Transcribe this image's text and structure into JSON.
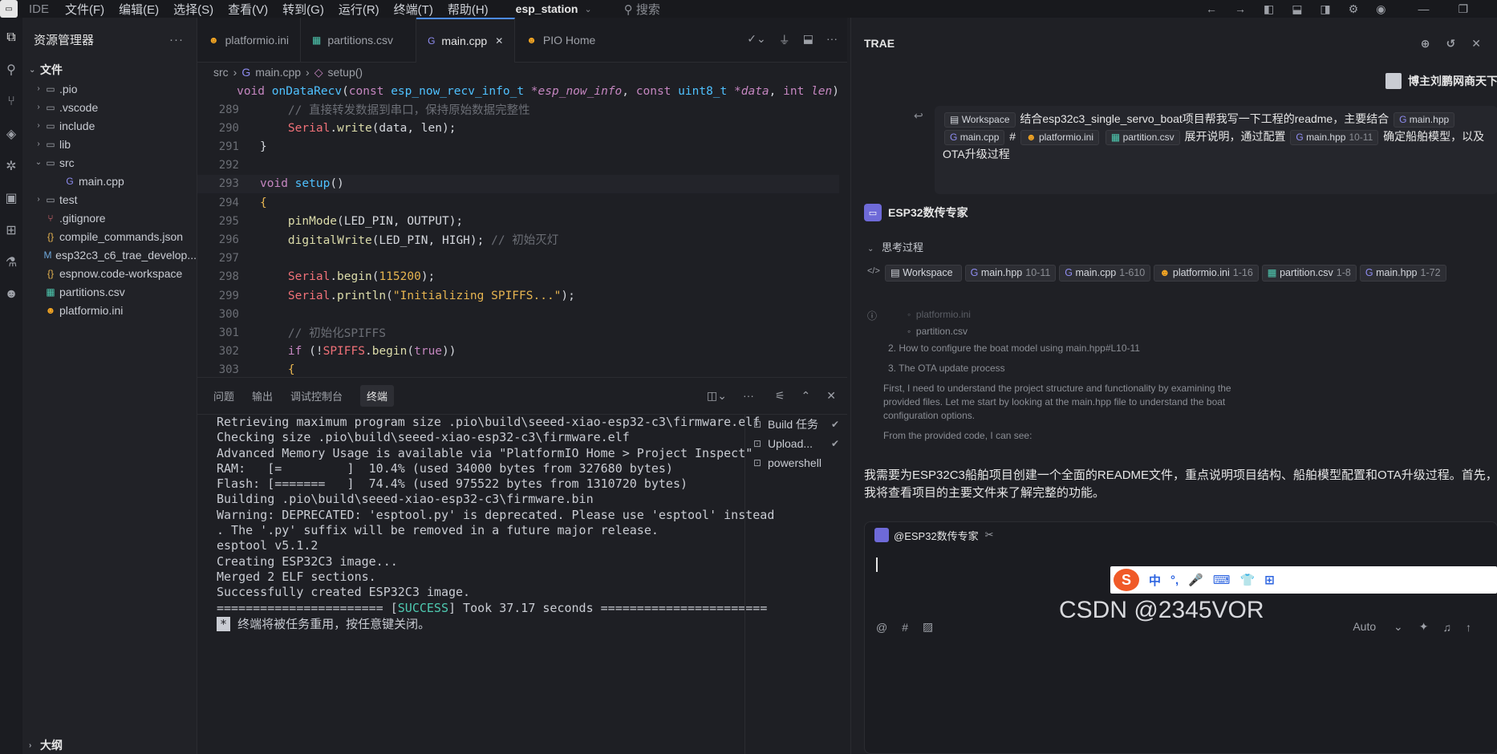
{
  "titlebar": {
    "ide": "IDE",
    "menu": [
      "文件(F)",
      "编辑(E)",
      "选择(S)",
      "查看(V)",
      "转到(G)",
      "运行(R)",
      "终端(T)",
      "帮助(H)"
    ],
    "project": "esp_station",
    "search": "搜索"
  },
  "explorer": {
    "title": "资源管理器",
    "section": "文件",
    "items": [
      {
        "arrow": "›",
        "icon": "folder-icon",
        "glyph": "▭",
        "label": ".pio"
      },
      {
        "arrow": "›",
        "icon": "folder-icon",
        "glyph": "▭",
        "label": ".vscode"
      },
      {
        "arrow": "›",
        "icon": "folder-icon",
        "glyph": "▭",
        "label": "include"
      },
      {
        "arrow": "›",
        "icon": "folder-icon",
        "glyph": "▭",
        "label": "lib"
      },
      {
        "arrow": "⌄",
        "icon": "folder-open-icon",
        "glyph": "▭",
        "label": "src"
      },
      {
        "arrow": "",
        "icon": "cpp-file-icon",
        "glyph": "G",
        "label": "main.cpp",
        "indent": true
      },
      {
        "arrow": "›",
        "icon": "folder-icon",
        "glyph": "▭",
        "label": "test"
      },
      {
        "arrow": "",
        "icon": "git-icon",
        "glyph": "⑂",
        "label": ".gitignore"
      },
      {
        "arrow": "",
        "icon": "json-icon",
        "glyph": "{}",
        "label": "compile_commands.json"
      },
      {
        "arrow": "",
        "icon": "markdown-icon",
        "glyph": "M",
        "label": "esp32c3_c6_trae_develop..."
      },
      {
        "arrow": "",
        "icon": "json-icon",
        "glyph": "{}",
        "label": "espnow.code-workspace"
      },
      {
        "arrow": "",
        "icon": "csv-icon",
        "glyph": "▦",
        "label": "partitions.csv"
      },
      {
        "arrow": "",
        "icon": "pio-icon",
        "glyph": "☻",
        "label": "platformio.ini"
      }
    ],
    "outline": "大纲"
  },
  "tabs": [
    {
      "label": "platformio.ini",
      "icon": "pio-icon",
      "glyph": "☻"
    },
    {
      "label": "partitions.csv",
      "icon": "csv-icon",
      "glyph": "▦"
    },
    {
      "label": "main.cpp",
      "icon": "cpp-file-icon",
      "glyph": "G",
      "active": true
    },
    {
      "label": "PIO Home",
      "icon": "pio-icon",
      "glyph": "☻"
    }
  ],
  "breadcrumb": [
    "src",
    "main.cpp",
    "setup()"
  ],
  "sticky": "void onDataRecv(const esp_now_recv_info_t *esp_now_info, const uint8_t *data, int len)",
  "code_lines": [
    {
      "n": "289",
      "html": "    <span class=\"cm\">// 直接转发数据到串口，保持原始数据完整性</span>"
    },
    {
      "n": "290",
      "html": "    <span class=\"ob\">Serial</span>.<span class=\"fn\">write</span>(data, len);"
    },
    {
      "n": "291",
      "html": "}"
    },
    {
      "n": "292",
      "html": ""
    },
    {
      "n": "293",
      "html": "<span class=\"kw\">void</span> <span class=\"ty\">setup</span>()"
    },
    {
      "n": "294",
      "html": "<span class=\"fy\">{</span>"
    },
    {
      "n": "295",
      "html": "    <span class=\"fn\">pinMode</span>(LED_PIN, OUTPUT);"
    },
    {
      "n": "296",
      "html": "    <span class=\"fn\">digitalWrite</span>(LED_PIN, HIGH); <span class=\"cm\">// 初始灭灯</span>"
    },
    {
      "n": "297",
      "html": ""
    },
    {
      "n": "298",
      "html": "    <span class=\"ob\">Serial</span>.<span class=\"fn\">begin</span>(<span class=\"nm\">115200</span>);"
    },
    {
      "n": "299",
      "html": "    <span class=\"ob\">Serial</span>.<span class=\"fn\">println</span>(<span class=\"st\">\"Initializing SPIFFS...\"</span>);"
    },
    {
      "n": "300",
      "html": ""
    },
    {
      "n": "301",
      "html": "    <span class=\"cm\">// 初始化SPIFFS</span>"
    },
    {
      "n": "302",
      "html": "    <span class=\"kw\">if</span> (!<span class=\"ob\">SPIFFS</span>.<span class=\"fn\">begin</span>(<span class=\"kw\">true</span>))"
    },
    {
      "n": "303",
      "html": "    <span class=\"fy\">{</span>"
    }
  ],
  "panel": {
    "tabs": [
      "问题",
      "输出",
      "调试控制台",
      "终端"
    ],
    "terminal": [
      "Retrieving maximum program size .pio\\build\\seeed-xiao-esp32-c3\\firmware.elf",
      "Checking size .pio\\build\\seeed-xiao-esp32-c3\\firmware.elf",
      "Advanced Memory Usage is available via \"PlatformIO Home > Project Inspect\"",
      "RAM:   [=         ]  10.4% (used 34000 bytes from 327680 bytes)",
      "Flash: [=======   ]  74.4% (used 975522 bytes from 1310720 bytes)",
      "Building .pio\\build\\seeed-xiao-esp32-c3\\firmware.bin",
      "Warning: DEPRECATED: 'esptool.py' is deprecated. Please use 'esptool' instead",
      ". The '.py' suffix will be removed in a future major release.",
      "esptool v5.1.2",
      "Creating ESP32C3 image...",
      "Merged 2 ELF sections.",
      "Successfully created ESP32C3 image."
    ],
    "success_prefix": "======================= [",
    "success_word": "SUCCESS",
    "success_suffix": "] Took 37.17 seconds =======================",
    "star": "*",
    "reuse": "终端将被任务重用，按任意键关闭。",
    "tasks": [
      {
        "label": "Build 任务",
        "check": true
      },
      {
        "label": "Upload...",
        "check": true
      },
      {
        "label": "powershell",
        "check": false
      }
    ]
  },
  "chat": {
    "title": "TRAE",
    "user": "博主刘鹏网商天下",
    "message_parts": [
      "Workspace",
      "结合esp32c3_single_servo_boat项目帮我写一下工程的readme，主要结合",
      "main.hpp",
      "main.cpp",
      "#",
      "platformio.ini",
      "partition.csv",
      "展开说明，通过配置",
      "main.hpp",
      "10-11",
      "确定船舶模型，以及OTA升级过程"
    ],
    "agent": "ESP32数传专家",
    "thinking": "思考过程",
    "refs": [
      {
        "label": "Workspace",
        "range": ""
      },
      {
        "label": "main.hpp",
        "range": "10-11"
      },
      {
        "label": "main.cpp",
        "range": "1-610"
      },
      {
        "label": "platformio.ini",
        "range": "1-16"
      },
      {
        "label": "partition.csv",
        "range": "1-8"
      },
      {
        "label": "main.hpp",
        "range": "1-72"
      }
    ],
    "thought_faint": [
      "platformio.ini",
      "partition.csv"
    ],
    "thought_lines": [
      "2. How to configure the boat model using main.hpp#L10-11",
      "3. The OTA update process",
      "First, I need to understand the project structure and functionality by examining the provided files. Let me start by looking at the main.hpp file to understand the boat configuration options.",
      "From the provided code, I can see:"
    ],
    "answer": "我需要为ESP32C3船舶项目创建一个全面的README文件，重点说明项目结构、船舶模型配置和OTA升级过程。首先，我将查看项目的主要文件来了解完整的功能。",
    "input_agent": "@ESP32数传专家",
    "auto": "Auto"
  },
  "ime": [
    "中",
    "°,",
    "🎤",
    "⌨",
    "👕",
    "⊞"
  ],
  "watermark": "CSDN @2345VOR"
}
